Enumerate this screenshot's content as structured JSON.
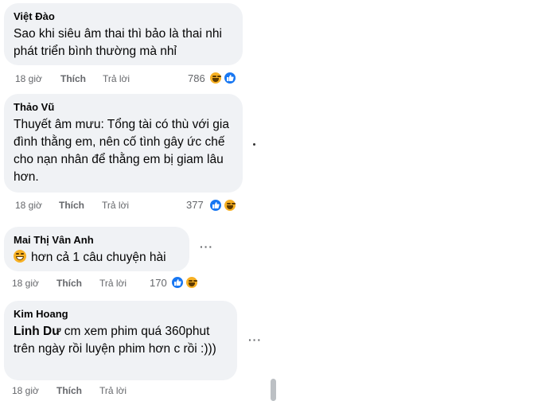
{
  "comments": [
    {
      "author": "Việt Đào",
      "text": "Sao khi siêu âm thai thì bảo là thai nhi phát triển bình thường mà nhỉ",
      "time": "18 giờ",
      "like_label": "Thích",
      "reply_label": "Trả lời",
      "reaction_count": "786",
      "reactions": [
        "haha-icon",
        "like-icon"
      ]
    },
    {
      "author": "Thảo Vũ",
      "text": "Thuyết âm mưu: Tổng tài có thù với gia đình thằng em, nên cố tình gây ức chế cho nạn nhân để thằng em bị giam lâu hơn.",
      "time": "18 giờ",
      "like_label": "Thích",
      "reply_label": "Trả lời",
      "reaction_count": "377",
      "reactions": [
        "like-icon",
        "haha-icon"
      ]
    },
    {
      "author": "Mai Thị Vân Anh",
      "text": "hơn cả 1 câu chuyện hài",
      "emoji": "laughing-emoji",
      "time": "18 giờ",
      "like_label": "Thích",
      "reply_label": "Trả lời",
      "reaction_count": "170",
      "reactions": [
        "like-icon",
        "haha-icon"
      ],
      "more_label": "···"
    },
    {
      "author": "Kim Hoang",
      "mention": "Linh Dư",
      "text": "cm xem phim quá 360phut trên ngày rồi luyện phim hơn c rồi :)))",
      "time": "18 giờ",
      "like_label": "Thích",
      "reply_label": "Trả lời",
      "more_label": "···"
    }
  ],
  "colors": {
    "bubble": "#f0f2f5",
    "meta_text": "#65676b",
    "like_blue": "#1877f2",
    "haha_yellow": "#f7b125"
  }
}
